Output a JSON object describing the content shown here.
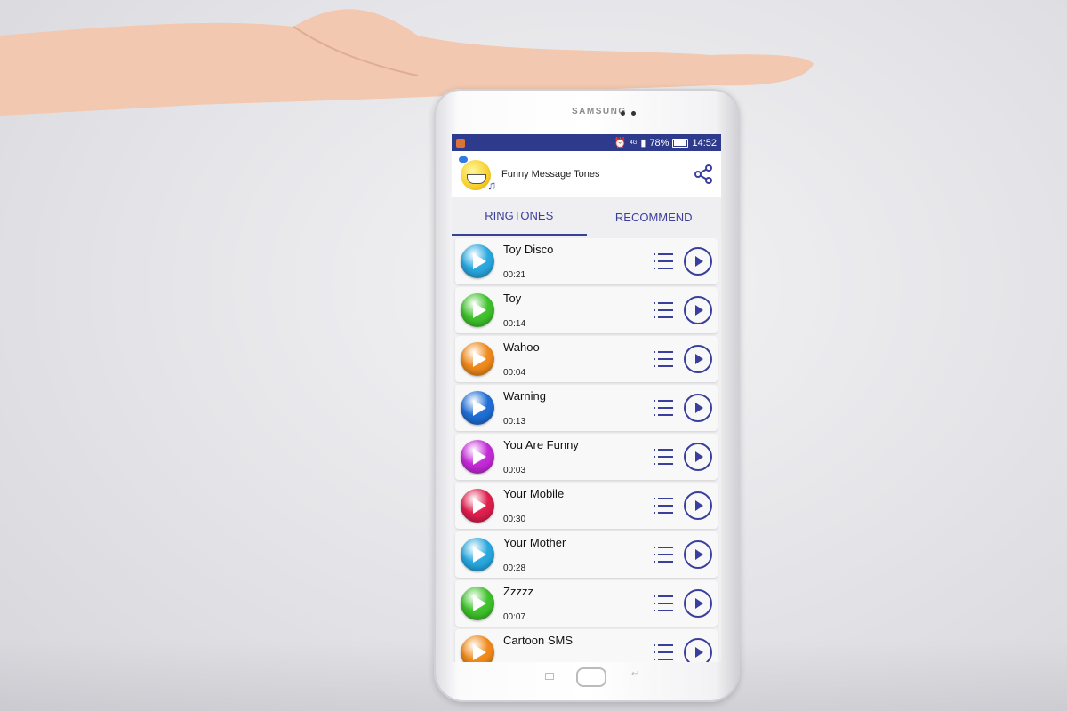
{
  "device": {
    "brand": "SAMSUNG"
  },
  "statusbar": {
    "alarm_icon": "alarm-icon",
    "network": "4G",
    "battery": "78%",
    "time": "14:52"
  },
  "appbar": {
    "title": "Funny Message Tones",
    "share_icon": "share-icon"
  },
  "tabs": [
    {
      "label": "RINGTONES",
      "active": true
    },
    {
      "label": "RECOMMEND",
      "active": false
    }
  ],
  "ringtones": [
    {
      "name": "Toy Disco",
      "duration": "00:21",
      "color": "#29a8e0"
    },
    {
      "name": "Toy",
      "duration": "00:14",
      "color": "#3fc22c"
    },
    {
      "name": "Wahoo",
      "duration": "00:04",
      "color": "#f08a1c"
    },
    {
      "name": "Warning",
      "duration": "00:13",
      "color": "#1f6fd6"
    },
    {
      "name": "You Are Funny",
      "duration": "00:03",
      "color": "#c42bd8"
    },
    {
      "name": "Your Mobile",
      "duration": "00:30",
      "color": "#e01f4e"
    },
    {
      "name": "Your Mother",
      "duration": "00:28",
      "color": "#29a8e0"
    },
    {
      "name": "Zzzzz",
      "duration": "00:07",
      "color": "#3fc22c"
    },
    {
      "name": "Cartoon SMS",
      "duration": "",
      "color": "#f08a1c"
    }
  ],
  "accent_color": "#3b3f9c",
  "statusbar_color": "#2e3a8c"
}
